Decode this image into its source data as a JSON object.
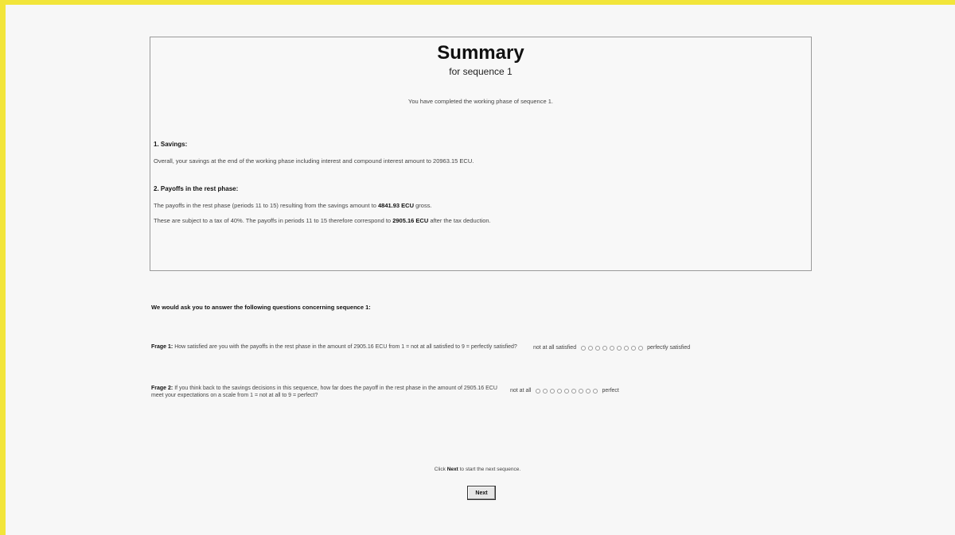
{
  "summary": {
    "title": "Summary",
    "subtitle": "for sequence 1",
    "completed_text": "You have completed the working phase of sequence 1.",
    "section1": {
      "heading": "1. Savings:",
      "text": "Overall, your savings at the end of the working phase including interest and compound interest amount to 20963.15 ECU."
    },
    "section2": {
      "heading": "2. Payoffs in the rest phase:",
      "line1_prefix": "The payoffs in the rest phase (periods 11 to 15) resulting from the savings amount to",
      "line1_value": "4841.93 ECU",
      "line1_suffix": "gross.",
      "line2_prefix": "These are subject to a tax of 40%. The payoffs in periods 11 to 15 therefore correspond to",
      "line2_value": "2905.16 ECU",
      "line2_suffix": "after the tax deduction."
    }
  },
  "questions": {
    "intro": "We would ask you to answer the following questions concerning sequence 1:",
    "q1": {
      "label": "Frage 1:",
      "text": "How satisfied are you with the payoffs in the rest phase in the amount of 2905.16 ECU from 1 = not at all satisfied to 9 = perfectly satisfied?",
      "scale_left": "not at all satisfied",
      "scale_right": "perfectly satisfied",
      "options": 9
    },
    "q2": {
      "label": "Frage 2:",
      "text": "If you think back to the savings decisions in this sequence, how far does the payoff in the rest phase in the amount of 2905.16 ECU meet your expectations on a scale from 1 = not at all to 9 = perfect?",
      "scale_left": "not at all",
      "scale_right": "perfect",
      "options": 9
    }
  },
  "footer": {
    "hint_prefix": "Click",
    "hint_bold": "Next",
    "hint_suffix": "to start the next sequence.",
    "next_label": "Next"
  }
}
